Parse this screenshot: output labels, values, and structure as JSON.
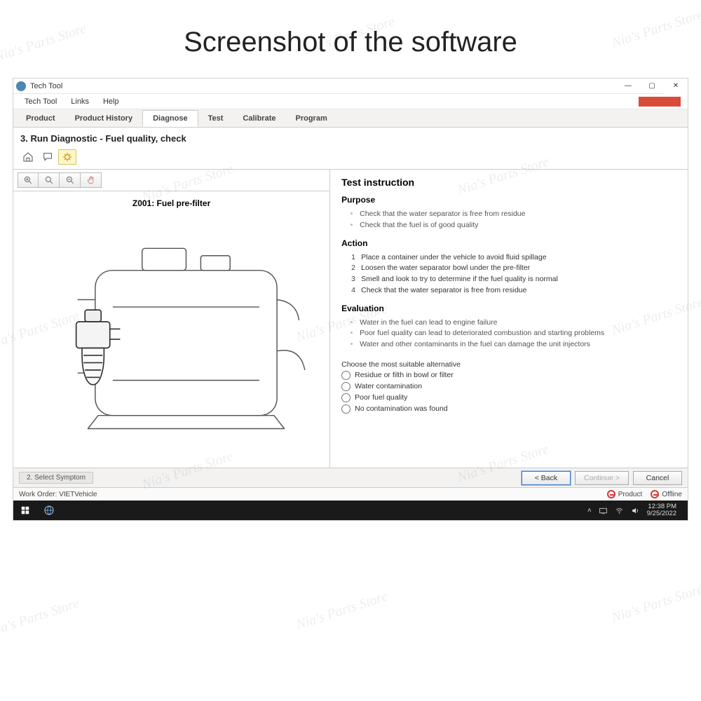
{
  "page_caption": "Screenshot of the software",
  "watermark_text": "Nia's Parts Store",
  "window": {
    "title": "Tech Tool",
    "controls": {
      "min": "—",
      "max": "▢",
      "close": "✕"
    }
  },
  "menubar": [
    "Tech Tool",
    "Links",
    "Help"
  ],
  "tabs": [
    "Product",
    "Product History",
    "Diagnose",
    "Test",
    "Calibrate",
    "Program"
  ],
  "active_tab_index": 2,
  "section_title": "3. Run Diagnostic - Fuel quality, check",
  "diagram_title": "Z001: Fuel pre-filter",
  "instruction": {
    "heading": "Test instruction",
    "purpose_heading": "Purpose",
    "purpose": [
      "Check that the water separator is free from residue",
      "Check that the fuel is of good quality"
    ],
    "action_heading": "Action",
    "action": [
      "Place a container under the vehicle to avoid fluid spillage",
      "Loosen the water separator bowl under the pre-filter",
      "Smell and look to try to determine if the fuel quality is normal",
      "Check that the water separator is free from residue"
    ],
    "evaluation_heading": "Evaluation",
    "evaluation": [
      "Water in the fuel can lead to engine failure",
      "Poor fuel quality can lead to deteriorated combustion and starting problems",
      "Water and other contaminants in the fuel can damage the unit injectors"
    ],
    "choice_prompt": "Choose the most suitable alternative",
    "choices": [
      "Residue or filth in bowl or filter",
      "Water contamination",
      "Poor fuel quality",
      "No contamination was found"
    ]
  },
  "bottom": {
    "step_pill": "2. Select Symptom",
    "buttons": {
      "back": "< Back",
      "continue": "Continue >",
      "cancel": "Cancel"
    }
  },
  "status": {
    "work_order_label": "Work Order:",
    "work_order_value": "VIETVehicle",
    "chips": [
      "Product",
      "Offline"
    ]
  },
  "taskbar": {
    "time": "12:38 PM",
    "date": "9/25/2022"
  }
}
